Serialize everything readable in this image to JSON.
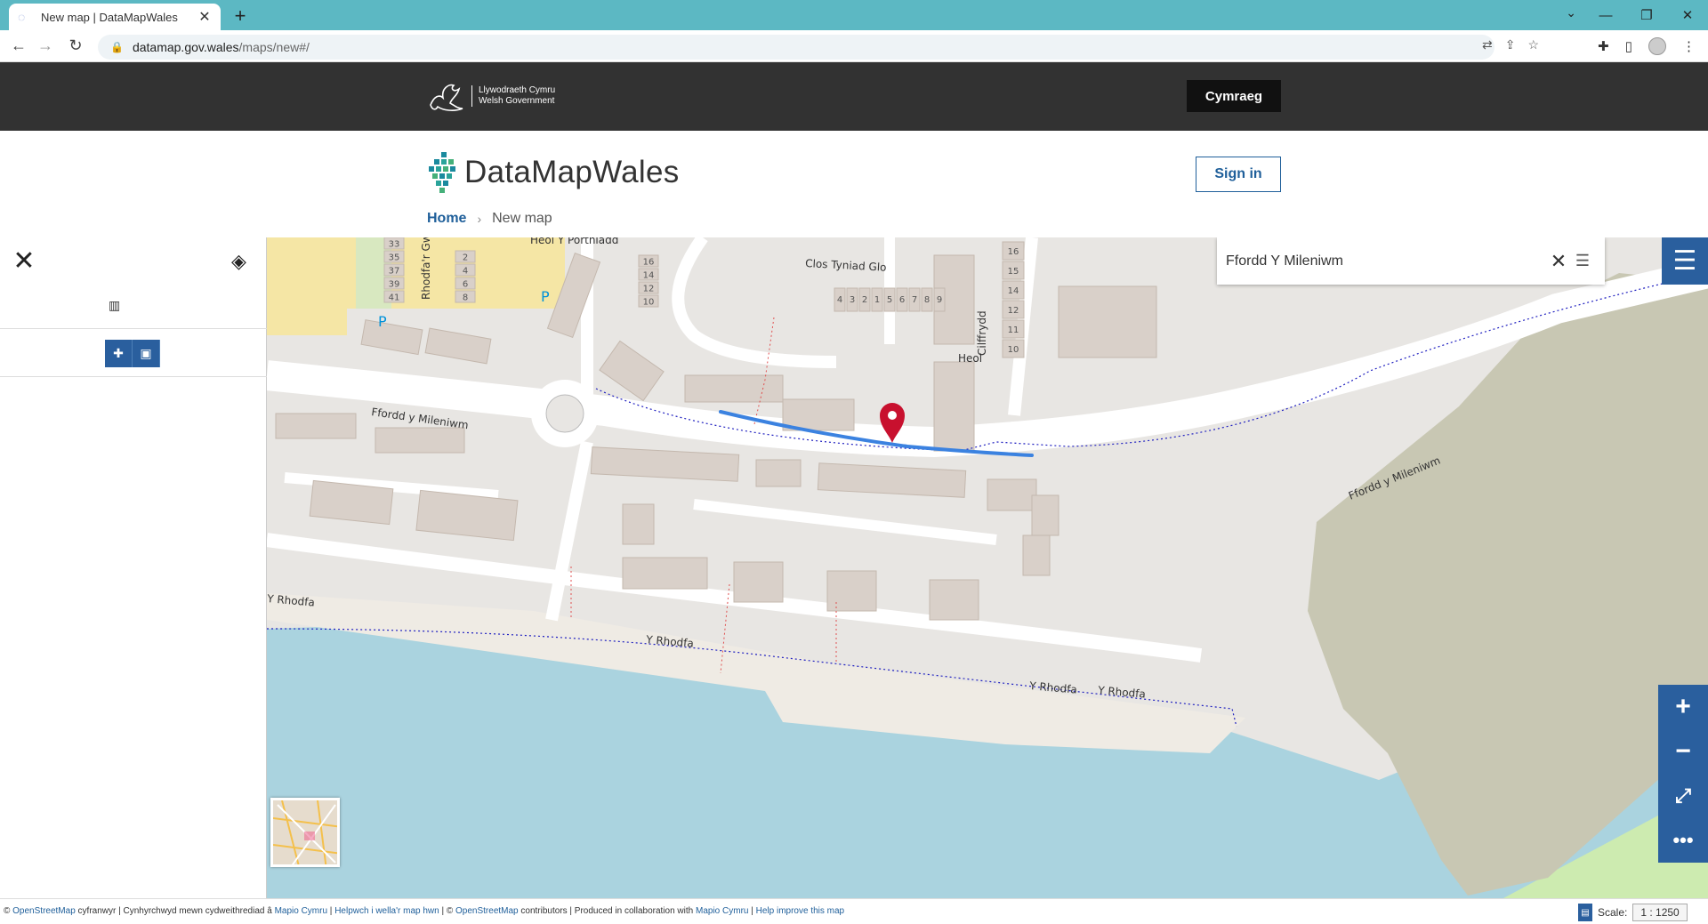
{
  "browser": {
    "tab_title": "New map | DataMapWales",
    "url_host": "datamap.gov.wales",
    "url_path": "/maps/new#/"
  },
  "gov_bar": {
    "logo_line1": "Llywodraeth Cymru",
    "logo_line2": "Welsh Government",
    "language_button": "Cymraeg"
  },
  "header": {
    "site_name": "DataMapWales",
    "sign_in": "Sign in",
    "breadcrumb": {
      "home": "Home",
      "current": "New map"
    }
  },
  "search": {
    "value": "Ffordd Y Mileniwm"
  },
  "map_labels": {
    "heol_porthladd": "Heol Y Porthladd",
    "clos_tyniad": "Clos Tyniad Glo",
    "rhodfa_gwe": "Rhodfa'r Gwe",
    "cilffrydd": "Cilffrydd",
    "heol": "Heol",
    "ffordd_west": "Ffordd y Mileniwm",
    "ffordd_east": "Ffordd y Mileniwm",
    "rhodfa_1": "Y Rhodfa",
    "rhodfa_2": "Y Rhodfa",
    "rhodfa_3": "Y Rhodfa",
    "rhodfa_4": "Y Rhodfa",
    "parking": "P",
    "house_numbers_left": [
      "33",
      "35",
      "37",
      "39",
      "41"
    ],
    "house_numbers_mid": [
      "2",
      "4",
      "6",
      "8"
    ],
    "house_numbers_mid2": [
      "16",
      "14",
      "12",
      "10"
    ],
    "house_numbers_row": [
      "4",
      "3",
      "2",
      "1",
      "5",
      "6",
      "7",
      "8",
      "9"
    ],
    "house_numbers_col": [
      "16",
      "15",
      "14",
      "12",
      "11",
      "10"
    ]
  },
  "status": {
    "attribution_1": "© ",
    "osm": "OpenStreetMap",
    "attribution_2": " cyfranwyr | Cynhyrchwyd mewn cydweithrediad â ",
    "mapio": "Mapio Cymru",
    "sep": " | ",
    "help_cy": "Helpwch i wella'r map hwn",
    "attribution_3": " | © ",
    "attribution_4": " contributors | Produced in collaboration with ",
    "help_en": "Help improve this map",
    "scale_label": "Scale:",
    "scale_value": "1 : 1250"
  },
  "colors": {
    "accent": "#2a5f9e",
    "route": "#3b82e0",
    "marker": "#c8102e",
    "water": "#aad3df"
  }
}
